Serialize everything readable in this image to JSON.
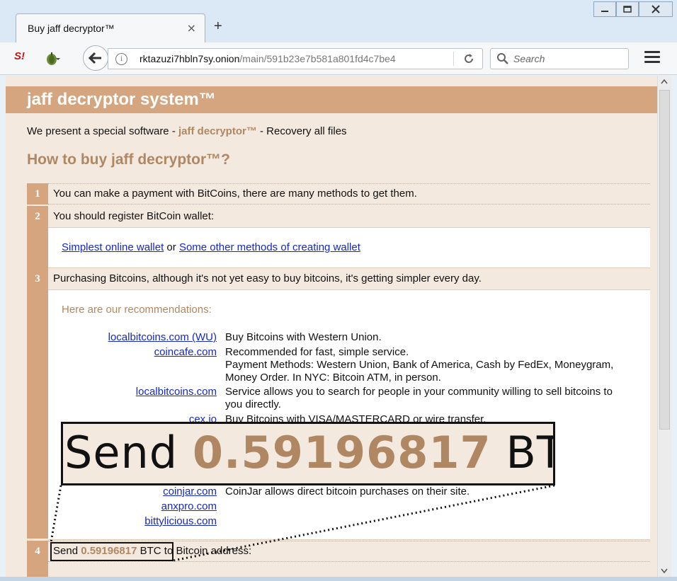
{
  "browser": {
    "tab_title": "Buy jaff decryptor™",
    "tab_close": "×",
    "new_tab": "+",
    "url_domain": "rktazuzi7hbln7sy.onion",
    "url_path": "/main/591b23e7b581a801fd4c7be4",
    "search_placeholder": "Search",
    "ext1_label": "S!"
  },
  "page": {
    "title": "jaff decryptor system™",
    "intro_before": "We present a special software - ",
    "intro_product": "jaff decryptor™",
    "intro_after": " - Recovery all files",
    "howto_heading": "How to buy jaff decryptor™?",
    "steps": [
      {
        "num": "1",
        "text": "You can make a payment with BitCoins, there are many methods to get them."
      },
      {
        "num": "2",
        "text": "You should register BitCoin wallet:"
      },
      {
        "num": "3",
        "text": "Purchasing Bitcoins, although it's not yet easy to buy bitcoins, it's getting simpler every day."
      },
      {
        "num": "4",
        "text_before": "Send ",
        "amount": "0.59196817",
        "text_mid": " BTC",
        "text_after": " to Bitcoin address:"
      }
    ],
    "wallet": {
      "link1": "Simplest online wallet",
      "or": " or ",
      "link2": "Some other methods of creating wallet"
    },
    "recommendations_title": "Here are our recommendations:",
    "recommendations": [
      {
        "site": "localbitcoins.com (WU)",
        "desc": "Buy Bitcoins with Western Union."
      },
      {
        "site": "coincafe.com",
        "desc": "Recommended for fast, simple service.",
        "desc2": "Payment Methods: Western Union, Bank of America, Cash by FedEx, Moneygram, Money Order. In NYC: Bitcoin ATM, in person."
      },
      {
        "site": "localbitcoins.com",
        "desc": "Service allows you to search for people in your community willing to sell bitcoins to you directly."
      },
      {
        "site": "cex.io",
        "desc": "Buy Bitcoins with VISA/MASTERCARD or wire transfer."
      },
      {
        "site": "coinjar.com",
        "desc": "CoinJar allows direct bitcoin purchases on their site."
      },
      {
        "site": "anxpro.com",
        "desc": ""
      },
      {
        "site": "bittylicious.com",
        "desc": ""
      }
    ],
    "zoom": {
      "text_before": "Send ",
      "amount": "0.59196817",
      "text_after": " BTC"
    }
  },
  "colors": {
    "accent": "#d4a57e",
    "accent_text": "#b08763",
    "page_bg": "#f4e9df",
    "link": "#1528c8"
  }
}
